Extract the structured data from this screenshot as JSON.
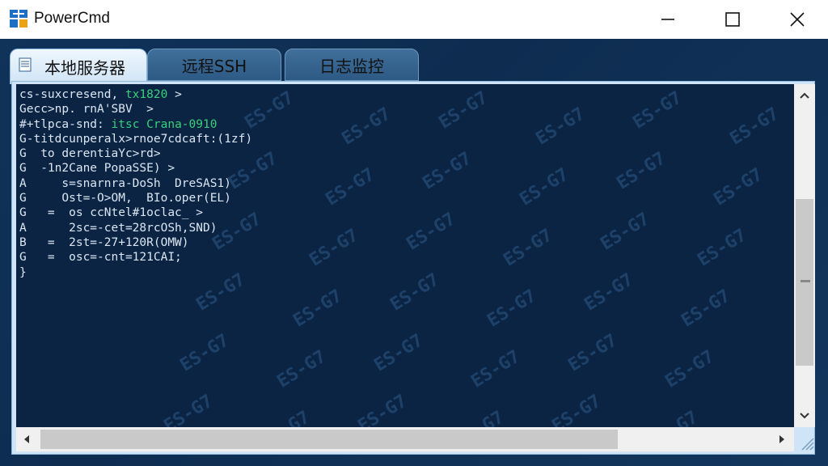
{
  "window": {
    "title": "PowerCmd"
  },
  "tabs": [
    {
      "label": "本地服务器",
      "active": true
    },
    {
      "label": "远程SSH",
      "active": false
    },
    {
      "label": "日志监控",
      "active": false
    }
  ],
  "terminal": {
    "lines": [
      {
        "text": "cs-suxcresend, ",
        "hl": "tx1820",
        "rest": " >"
      },
      {
        "text": "Gecc>np. rnA'SBV  >",
        "hl": "",
        "rest": ""
      },
      {
        "text": "#+tlpca-snd: ",
        "hl": "itsc Crana-0910",
        "rest": ""
      },
      {
        "text": "G-titdcunperalx>rnoe7cdcaft:(1zf)",
        "hl": "",
        "rest": ""
      },
      {
        "text": "G  to derentiaYc>rd>",
        "hl": "",
        "rest": ""
      },
      {
        "text": "G  -1n2Cane PopaSSE) >",
        "hl": "",
        "rest": ""
      },
      {
        "text": "A     s=snarnra-DoSh  DreSAS1)",
        "hl": "",
        "rest": ""
      },
      {
        "text": "G     Ost=-O>OM,  BIo.oper(EL)",
        "hl": "",
        "rest": ""
      },
      {
        "text": "G   =  os ccNtel#1oclac_ >",
        "hl": "",
        "rest": ""
      },
      {
        "text": "A      2sc=-cet=28rcOSh,SND)",
        "hl": "",
        "rest": ""
      },
      {
        "text": "B   =  2st=-27+120R(OMW)",
        "hl": "",
        "rest": ""
      },
      {
        "text": "G   =  osc=-cnt=121CAI;",
        "hl": "",
        "rest": ""
      },
      {
        "text": "}",
        "hl": "",
        "rest": ""
      }
    ],
    "watermarks": [
      "ES-G7"
    ],
    "text_color": "#dbe6f2",
    "accent_color": "#37d07a"
  },
  "scrollbars": {
    "vertical_position": 0.34,
    "horizontal_position": 0.0
  }
}
